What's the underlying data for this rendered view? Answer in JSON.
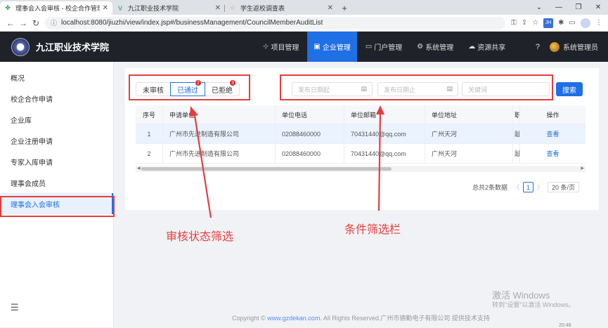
{
  "browser": {
    "tabs": [
      {
        "title": "理事会入会审核 - 校企合作管理",
        "active": true
      },
      {
        "title": "九江职业技术学院",
        "active": false
      },
      {
        "title": "学生返校调查表",
        "active": false
      }
    ],
    "url": "localhost:8080/jiuzhi/view/index.jsp#/businessManagement/CouncilMemberAuditList",
    "ext_badge": "JH"
  },
  "header": {
    "brand": "九江职业技术学院",
    "nav": [
      {
        "label": "项目管理",
        "icon": "tree-icon",
        "active": false
      },
      {
        "label": "企业管理",
        "icon": "building-icon",
        "active": true
      },
      {
        "label": "门户管理",
        "icon": "monitor-icon",
        "active": false
      },
      {
        "label": "系统管理",
        "icon": "gear-icon",
        "active": false
      },
      {
        "label": "资源共享",
        "icon": "cloud-icon",
        "active": false
      }
    ],
    "user": "系统管理员"
  },
  "sidebar": {
    "items": [
      {
        "label": "概况"
      },
      {
        "label": "校企合作申请"
      },
      {
        "label": "企业库"
      },
      {
        "label": "企业注册申请"
      },
      {
        "label": "专家入库申请"
      },
      {
        "label": "理事会成员"
      },
      {
        "label": "理事会入会审核",
        "active": true
      }
    ]
  },
  "filters": {
    "status": [
      "未审核",
      "已通过",
      "已拒绝"
    ],
    "selected": "已通过",
    "badges": [
      "2",
      "3"
    ],
    "date_start_placeholder": "发布日期起",
    "date_end_placeholder": "发布日期止",
    "keyword_placeholder": "关键词",
    "search_label": "搜索"
  },
  "table": {
    "headers": [
      "序号",
      "申请单位",
      "单位电话",
      "单位邮箱",
      "单位地址",
      "职",
      "操作"
    ],
    "rows": [
      [
        "1",
        "广州市先进制造有限公司",
        "02088460000",
        "70431440@qq.com",
        "广州天河",
        "趾",
        "查看"
      ],
      [
        "2",
        "广州市先进制造有限公司",
        "02088460000",
        "70431440@qq.com",
        "广州天河",
        "趾",
        "查看"
      ]
    ]
  },
  "pagination": {
    "total": "总共2条数据",
    "current_page": "1",
    "page_size": "20 条/页"
  },
  "annotations": {
    "status_filter": "审核状态筛选",
    "condition_filter": "条件筛选栏"
  },
  "footer": {
    "prefix": "Copyright ©",
    "link": "www.gzdekan.com",
    "suffix": ". All Rights Reserved.广州市德勤电子有限公司 提供技术支持"
  },
  "watermark": {
    "line1": "激活 Windows",
    "line2": "转到\"设置\"以激活 Windows。"
  },
  "tray_time": "20:48",
  "colors": {
    "accent": "#1f6fe5",
    "header_bg": "#1f2229",
    "annotation": "#e53e3e"
  }
}
